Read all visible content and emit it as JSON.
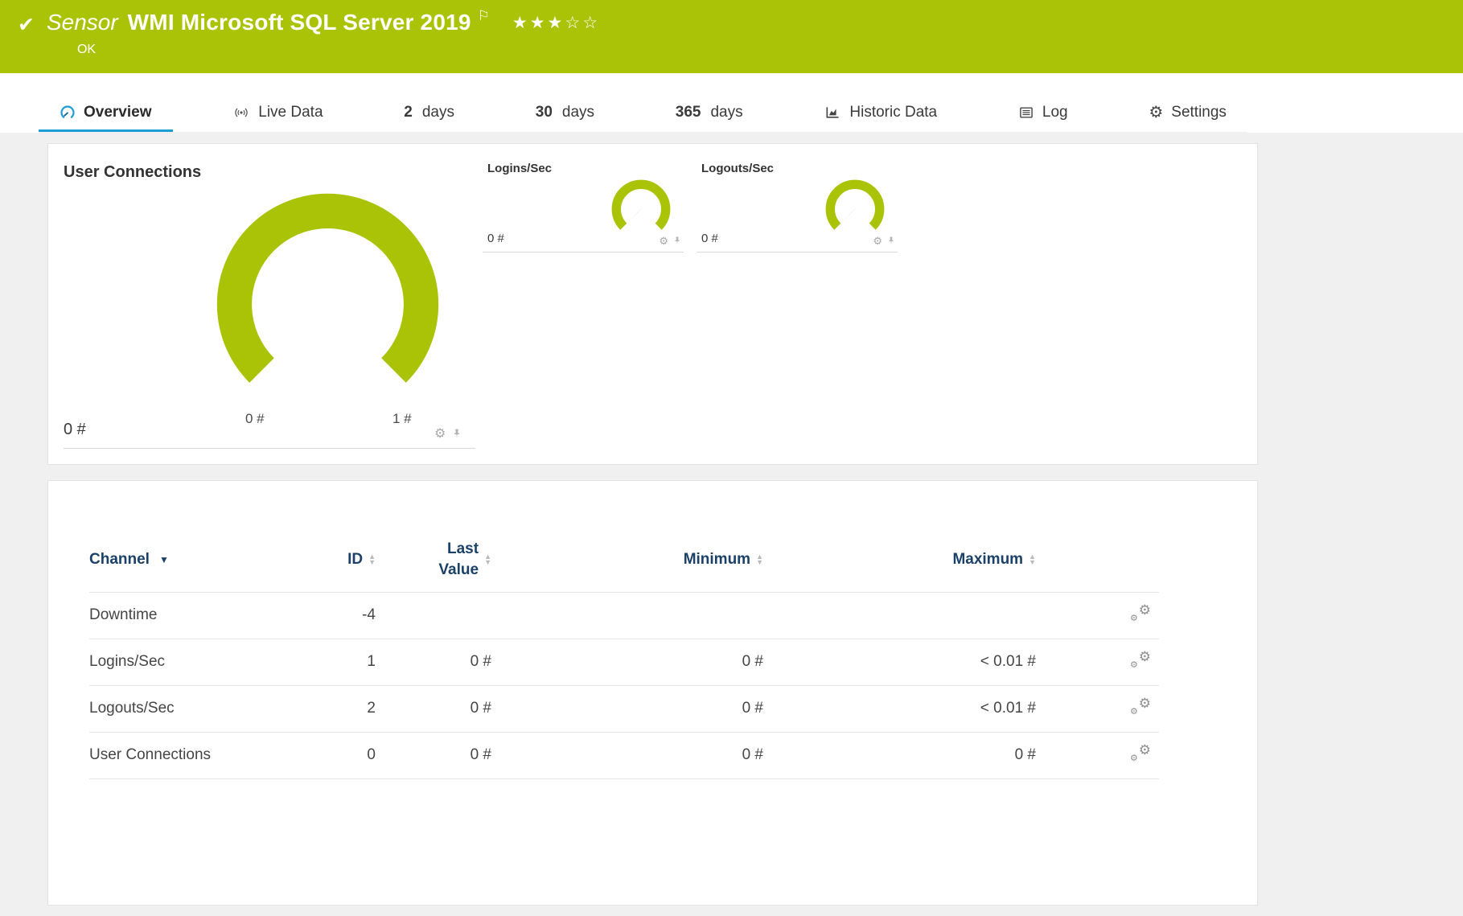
{
  "header": {
    "kind": "Sensor",
    "title": "WMI Microsoft SQL Server 2019",
    "status": "OK"
  },
  "icons": {
    "check": "✔",
    "flag": "⚐",
    "stars": "★★★☆☆",
    "gear": "⚙",
    "sort_up": "▲",
    "sort_down": "▼",
    "channel_sort": "▼"
  },
  "tabs": [
    {
      "label": "Overview",
      "active": true
    },
    {
      "label": "Live Data"
    },
    {
      "num": "2",
      "label": "days"
    },
    {
      "num": "30",
      "label": "days"
    },
    {
      "num": "365",
      "label": "days"
    },
    {
      "label": "Historic Data"
    },
    {
      "label": "Log"
    },
    {
      "label": "Settings"
    }
  ],
  "gauges": {
    "main": {
      "title": "User Connections",
      "value": "0 #",
      "scale_min": "0 #",
      "scale_max": "1 #"
    },
    "small": [
      {
        "title": "Logins/Sec",
        "value": "0 #"
      },
      {
        "title": "Logouts/Sec",
        "value": "0 #"
      }
    ]
  },
  "table": {
    "headers": {
      "channel": "Channel",
      "id": "ID",
      "last1": "Last",
      "last2": "Value",
      "minimum": "Minimum",
      "maximum": "Maximum"
    },
    "rows": [
      {
        "channel": "Downtime",
        "id": "-4",
        "last_value": "",
        "minimum": "",
        "maximum": ""
      },
      {
        "channel": "Logins/Sec",
        "id": "1",
        "last_value": "0 #",
        "minimum": "0 #",
        "maximum": "< 0.01 #"
      },
      {
        "channel": "Logouts/Sec",
        "id": "2",
        "last_value": "0 #",
        "minimum": "0 #",
        "maximum": "< 0.01 #"
      },
      {
        "channel": "User Connections",
        "id": "0",
        "last_value": "0 #",
        "minimum": "0 #",
        "maximum": "0 #"
      }
    ]
  },
  "colors": {
    "brand_green": "#abc306",
    "tab_blue": "#1e9cd7",
    "navy": "#1b4168"
  }
}
